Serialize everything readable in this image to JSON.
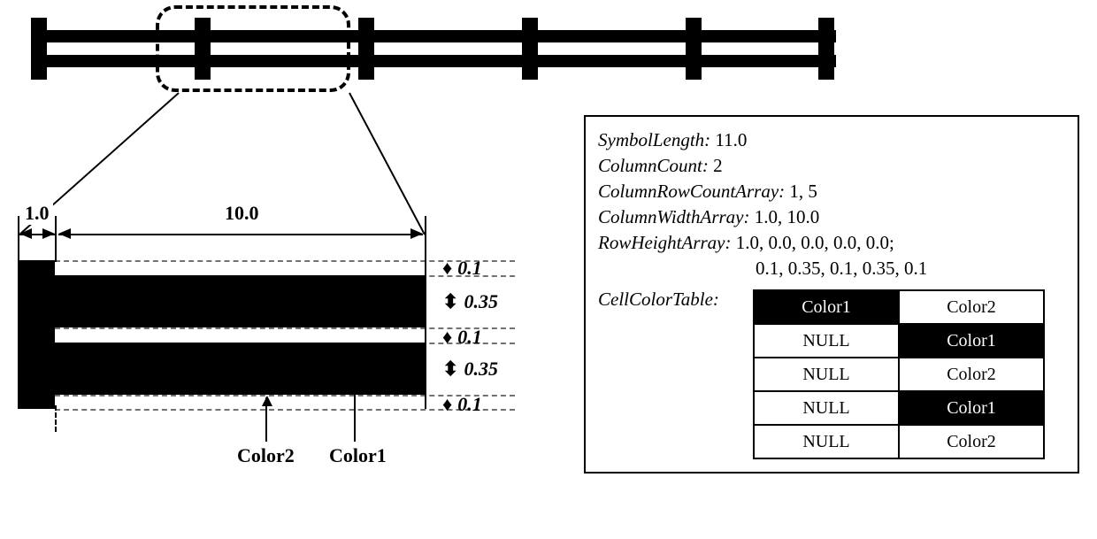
{
  "diagram": {
    "top_dims": {
      "col1": "1.0",
      "col2": "10.0"
    },
    "row_heights": [
      "0.1",
      "0.35",
      "0.1",
      "0.35",
      "0.1"
    ],
    "color_labels": {
      "c1": "Color1",
      "c2": "Color2"
    }
  },
  "params": {
    "SymbolLength": "11.0",
    "ColumnCount": "2",
    "ColumnRowCountArray": "1, 5",
    "ColumnWidthArray": "1.0, 10.0",
    "RowHeightArray_line1": "1.0, 0.0, 0.0, 0.0, 0.0;",
    "RowHeightArray_line2": "0.1, 0.35, 0.1, 0.35, 0.1",
    "CellColorTable": [
      {
        "c0": "Color1",
        "d0": true,
        "c1": "Color2",
        "d1": false
      },
      {
        "c0": "NULL",
        "d0": false,
        "c1": "Color1",
        "d1": true
      },
      {
        "c0": "NULL",
        "d0": false,
        "c1": "Color2",
        "d1": false
      },
      {
        "c0": "NULL",
        "d0": false,
        "c1": "Color1",
        "d1": true
      },
      {
        "c0": "NULL",
        "d0": false,
        "c1": "Color2",
        "d1": false
      }
    ]
  },
  "labels": {
    "SymbolLength": "SymbolLength:",
    "ColumnCount": "ColumnCount:",
    "ColumnRowCountArray": "ColumnRowCountArray:",
    "ColumnWidthArray": "ColumnWidthArray:",
    "RowHeightArray": "RowHeightArray:",
    "CellColorTable": "CellColorTable:"
  }
}
